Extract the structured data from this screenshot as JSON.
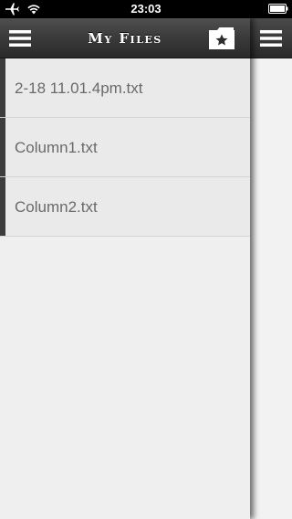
{
  "status_bar": {
    "time": "23:03",
    "icons": [
      "airplane-icon",
      "wifi-icon",
      "battery-icon"
    ]
  },
  "navbar": {
    "title": "My Files",
    "left_icon": "menu-icon",
    "right_icon": "star-folder-icon"
  },
  "files": [
    {
      "name": "2-18 11.01.4pm.txt"
    },
    {
      "name": "Column1.txt"
    },
    {
      "name": "Column2.txt"
    }
  ],
  "back_panel": {
    "icon": "menu-icon"
  },
  "colors": {
    "nav_bg": "#3a3a3a",
    "list_bg": "#efefef",
    "row_marker": "#3d3d3d",
    "file_text": "#6a6a6a"
  }
}
